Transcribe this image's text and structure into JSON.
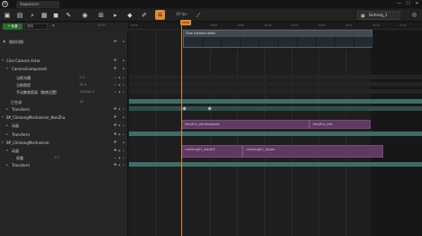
{
  "window": {
    "logo": "U",
    "tab_title": "Sequencer",
    "buttons": [
      "—",
      "☐",
      "✕"
    ]
  },
  "toolbar": {
    "icons": [
      "save-icon",
      "folder-icon",
      "search-icon",
      "render-icon",
      "camera-icon",
      "key-icon",
      "playback-icon",
      "snap-icon",
      "settings-icon",
      "selection-icon",
      "curve-icon",
      "marker-icon",
      "lock-icon"
    ],
    "fps_label": "30 fps",
    "sequence_name": "Sicheng_1"
  },
  "left_panel": {
    "add_track_label": "+ 轨道",
    "search_placeholder": "搜索",
    "frame_label": "0000",
    "rows": [
      {
        "label": "相机切换",
        "indent": 3,
        "kind": "header"
      },
      {
        "label": "Cine Camera Actor",
        "indent": 3,
        "kind": "actor"
      },
      {
        "label": "CameraComponent",
        "indent": 8,
        "kind": "component"
      },
      {
        "label": "当前光圈",
        "indent": 14,
        "kind": "prop",
        "value": "2.8"
      },
      {
        "label": "当前焦距",
        "indent": 14,
        "kind": "prop",
        "value": "35.0"
      },
      {
        "label": "手动聚焦距离（聚焦设置）",
        "indent": 14,
        "kind": "prop",
        "value": "100000.0"
      },
      {
        "label": "已生成",
        "indent": 8,
        "kind": "spawn"
      },
      {
        "label": "Transform",
        "indent": 8,
        "kind": "transform"
      },
      {
        "label": "BP_ClimbingMechanism_NanZhu",
        "indent": 3,
        "kind": "actor"
      },
      {
        "label": "动画",
        "indent": 8,
        "kind": "anim"
      },
      {
        "label": "Transform",
        "indent": 8,
        "kind": "transform"
      },
      {
        "label": "BP_ClimbingMechanism",
        "indent": 3,
        "kind": "actor"
      },
      {
        "label": "动画",
        "indent": 8,
        "kind": "anim"
      },
      {
        "label": "权重",
        "indent": 14,
        "kind": "prop",
        "value": "1.0"
      },
      {
        "label": "Transform",
        "indent": 8,
        "kind": "transform"
      }
    ]
  },
  "timeline": {
    "playhead_label": "0000",
    "ruler_ticks": [
      "0000",
      "0030",
      "0060",
      "0090",
      "0120",
      "0150",
      "0180",
      "0210",
      "0240",
      "0270"
    ],
    "camera_section_label": "Cine Camera Actor",
    "clips": [
      {
        "label": "NanZhu_climbingstart",
        "row": "nanzhu-a"
      },
      {
        "label": "NanZhu_idle",
        "row": "nanzhu-b"
      },
      {
        "label": "climbing01_start01",
        "row": "climb-a"
      },
      {
        "label": "climbing01_2pose",
        "row": "climb-b"
      }
    ]
  }
}
